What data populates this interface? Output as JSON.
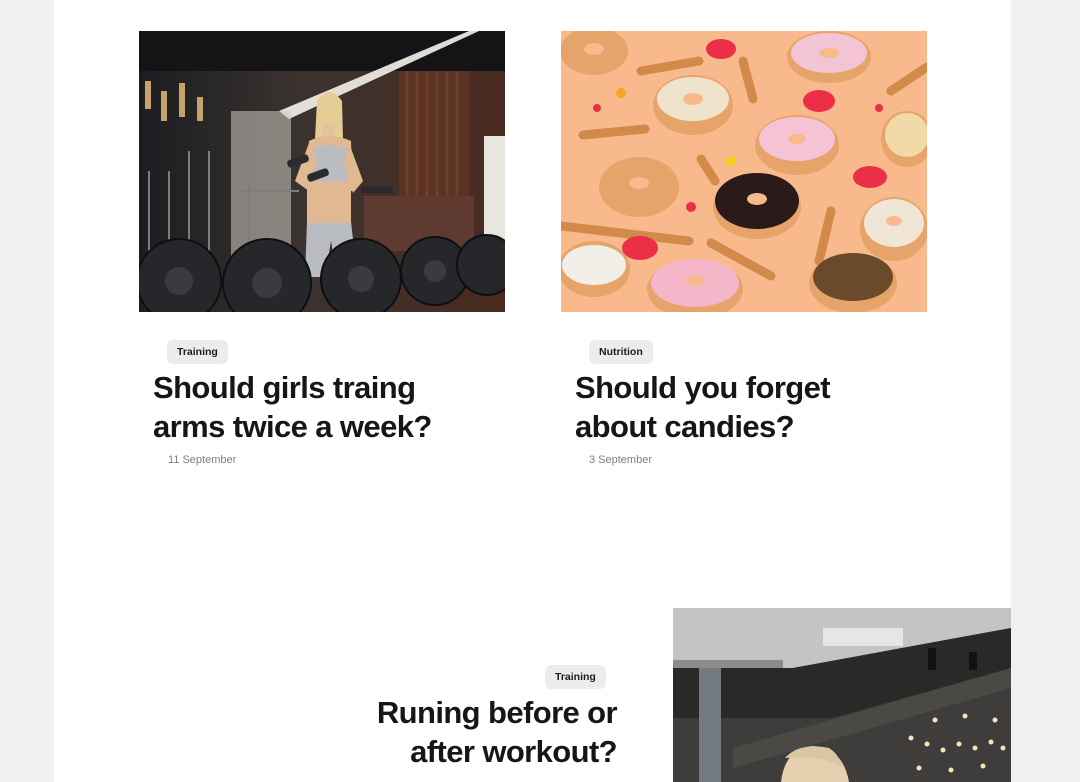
{
  "posts": [
    {
      "tag": "Training",
      "title_line1": "Should girls traing",
      "title_line2": "arms twice a week?",
      "date": "11 September",
      "image_subject": "gym-woman-dumbbells"
    },
    {
      "tag": "Nutrition",
      "title_line1": "Should you forget",
      "title_line2": "about candies?",
      "date": "3 September",
      "image_subject": "donuts-and-candies"
    },
    {
      "tag": "Training",
      "title_line1": "Runing before or",
      "title_line2": "after workout?",
      "date": "",
      "image_subject": "gym-interior-person"
    }
  ],
  "colors": {
    "page_bg": "#f1f1f1",
    "card_bg": "#ffffff",
    "tag_bg": "#ececec",
    "title": "#161616",
    "date": "#7f7f7f"
  }
}
